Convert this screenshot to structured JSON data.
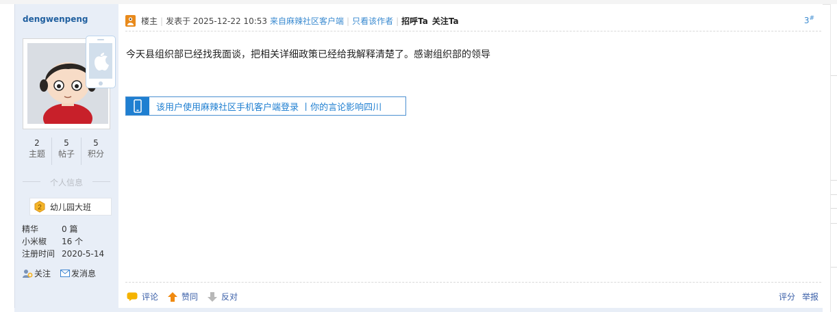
{
  "author": {
    "name": "dengwenpeng",
    "stats": [
      {
        "num": "2",
        "label": "主题"
      },
      {
        "num": "5",
        "label": "帖子"
      },
      {
        "num": "5",
        "label": "积分"
      }
    ],
    "section_title": "个人信息",
    "rank": {
      "level": "2",
      "name": "幼儿园大班"
    },
    "profile": [
      {
        "key": "精华",
        "value": "0 篇"
      },
      {
        "key": "小米椒",
        "value": "16 个"
      },
      {
        "key": "注册时间",
        "value": "2020-5-14"
      }
    ],
    "actions": {
      "follow": "关注",
      "message": "发消息"
    }
  },
  "post": {
    "role": "楼主",
    "posted_label": "发表于 2025-12-22 10:53",
    "client": "来自麻辣社区客户端",
    "only_author": "只看该作者",
    "greet": "招呼Ta",
    "follow": "关注Ta",
    "floor": "3",
    "floor_sup": "#",
    "content": "今天县组织部已经找我面谈，把相关详细政策已经给我解释清楚了。感谢组织部的领导",
    "client_banner": "该用户使用麻辣社区手机客户端登录 丨你的言论影响四川"
  },
  "footer": {
    "comment": "评论",
    "like": "赞同",
    "oppose": "反对",
    "rate": "评分",
    "report": "举报"
  },
  "colors": {
    "sidebar_bg": "#e8eef7",
    "link_blue": "#3a8ad0",
    "banner_blue": "#1f7fd1",
    "author_name": "#1f5f9f"
  }
}
